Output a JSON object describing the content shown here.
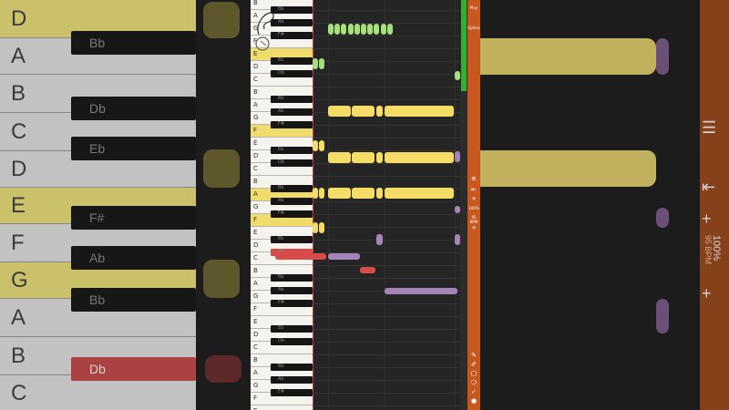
{
  "background": {
    "white_keys": [
      "A",
      "B",
      "C",
      "D",
      "E",
      "F",
      "G",
      "A",
      "B",
      "C",
      "D"
    ],
    "black_keys": [
      "Bb",
      "Db",
      "Eb",
      "F#",
      "Ab",
      "Bb",
      "Db"
    ]
  },
  "keyboard": {
    "octave_pattern": [
      "B",
      "A",
      "G",
      "F",
      "E",
      "D",
      "C"
    ],
    "black_labels": [
      "Bb",
      "Ab",
      "F#",
      "Eb",
      "Db"
    ]
  },
  "side_panel": {
    "tab1": "Play",
    "tab2": "Options",
    "zoom_label": "100%",
    "tempo": "95 BPM",
    "tempo_bg_label": "95 BPM",
    "zoom_bg_label": "100%"
  },
  "colors": {
    "green_note": "#a6e07a",
    "yellow_note": "#f4dc66",
    "purple_note": "#a585b8",
    "red_note": "#d94b4b",
    "accent_orange": "#c9581f"
  }
}
